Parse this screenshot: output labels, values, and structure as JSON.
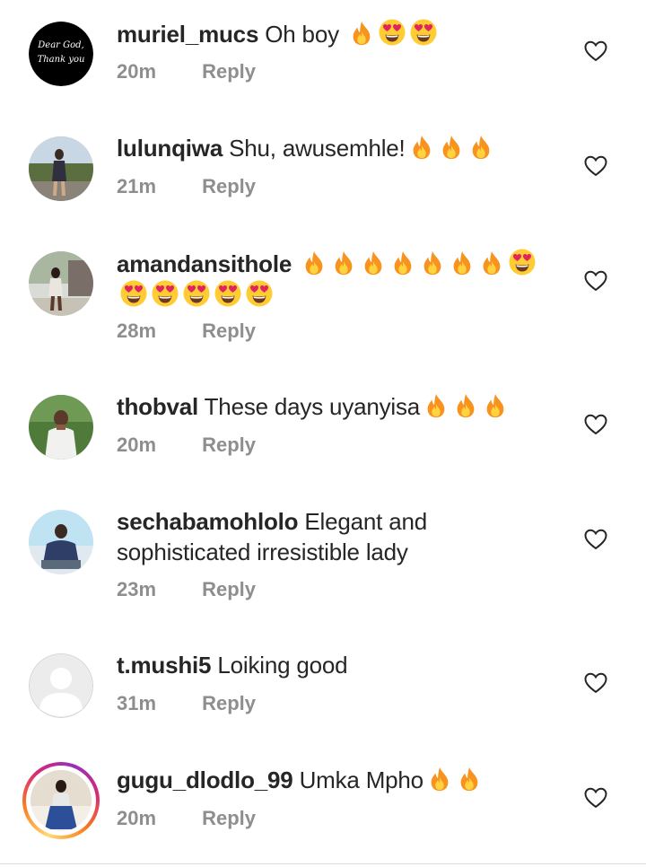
{
  "comments": [
    {
      "username": "muriel_mucs",
      "text": "Oh boy",
      "emojis": [
        "fire",
        "heart-eyes",
        "heart-eyes"
      ],
      "time": "20m",
      "reply": "Reply",
      "avatar": "dark-text",
      "avatar_text": [
        "Dear God,",
        "Thank you"
      ]
    },
    {
      "username": "lulunqiwa",
      "text": "Shu, awusemhle!",
      "emojis": [
        "fire",
        "fire",
        "fire"
      ],
      "time": "21m",
      "reply": "Reply",
      "avatar": "photo-outdoor"
    },
    {
      "username": "amandansithole",
      "text": "",
      "emojis": [
        "fire",
        "fire",
        "fire",
        "fire",
        "fire",
        "fire",
        "fire",
        "heart-eyes",
        "heart-eyes",
        "heart-eyes",
        "heart-eyes",
        "heart-eyes",
        "heart-eyes"
      ],
      "time": "28m",
      "reply": "Reply",
      "avatar": "photo-outdoor"
    },
    {
      "username": "thobval",
      "text": "These days uyanyisa",
      "emojis": [
        "fire",
        "fire",
        "fire"
      ],
      "time": "20m",
      "reply": "Reply",
      "avatar": "photo-green"
    },
    {
      "username": "sechabamohlolo",
      "text": "Elegant and sophisticated irresistible lady",
      "emojis": [],
      "time": "23m",
      "reply": "Reply",
      "avatar": "photo-sky"
    },
    {
      "username": "t.mushi5",
      "text": "Loiking good",
      "emojis": [],
      "time": "31m",
      "reply": "Reply",
      "avatar": "default"
    },
    {
      "username": "gugu_dlodlo_99",
      "text": "Umka Mpho",
      "emojis": [
        "fire",
        "fire"
      ],
      "time": "20m",
      "reply": "Reply",
      "avatar": "story-ring"
    }
  ],
  "icons": {
    "like": "heart-outline-icon",
    "fire": "fire-emoji",
    "heart-eyes": "heart-eyes-emoji"
  },
  "colors": {
    "username": "#262626",
    "meta": "#8e8e8e",
    "heart_outline": "#262626",
    "story_ring_start": "#feda75",
    "story_ring_end": "#d62976"
  }
}
